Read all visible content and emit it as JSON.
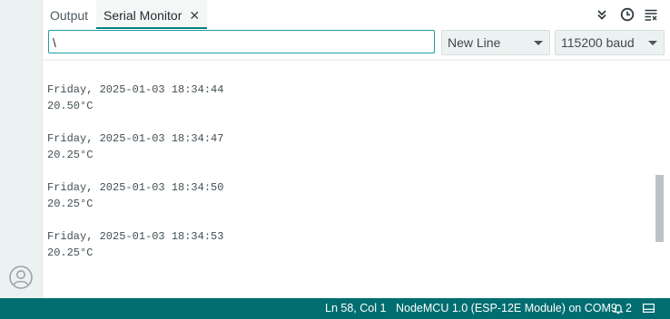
{
  "tabs": [
    {
      "label": "Output",
      "active": false
    },
    {
      "label": "Serial Monitor",
      "active": true
    }
  ],
  "toolbar_icons": [
    "double-chevron-down-icon",
    "clock-icon",
    "clear-output-icon"
  ],
  "message_input": {
    "value": "\\"
  },
  "line_ending": {
    "selected": "New Line"
  },
  "baud_rate": {
    "selected": "115200 baud"
  },
  "log_lines": [
    "20.50°C",
    "",
    "Friday, 2025-01-03 18:34:44",
    "20.50°C",
    "",
    "Friday, 2025-01-03 18:34:47",
    "20.25°C",
    "",
    "Friday, 2025-01-03 18:34:50",
    "20.25°C",
    "",
    "Friday, 2025-01-03 18:34:53",
    "20.25°C"
  ],
  "status": {
    "cursor_position": "Ln 58, Col 1",
    "board": "NodeMCU 1.0 (ESP-12E Module) on COM9",
    "notification_count": "2"
  },
  "colors": {
    "accent": "#008184",
    "statusbar": "#006d70",
    "input_border": "#1f9ea1"
  }
}
